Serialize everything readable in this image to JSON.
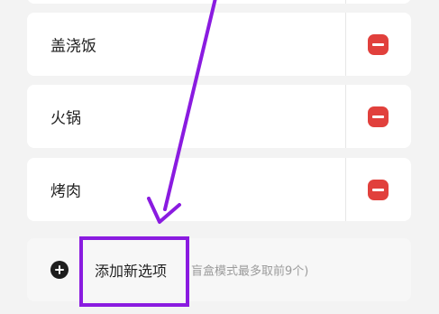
{
  "items": [
    {
      "label": "盖浇饭"
    },
    {
      "label": "火锅"
    },
    {
      "label": "烤肉"
    }
  ],
  "add_option": {
    "label": "添加新选项",
    "hint": "盲盒模式最多取前9个)"
  },
  "icons": {
    "delete": "minus-icon",
    "add": "plus-circle-icon"
  },
  "colors": {
    "delete_button": "#e1403c",
    "annotation": "#8a1be0",
    "background": "#f3f3f3",
    "card": "#ffffff"
  }
}
